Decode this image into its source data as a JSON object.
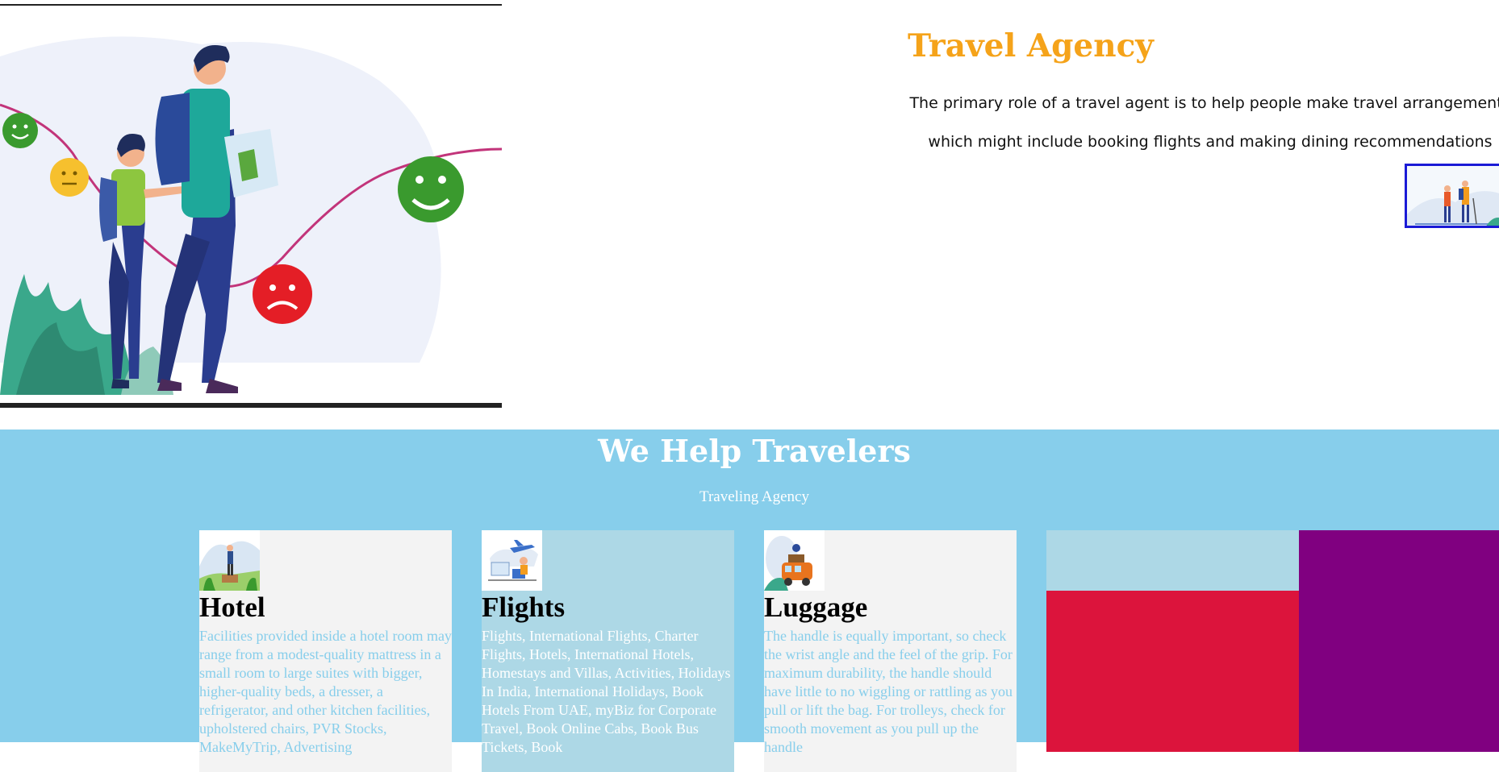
{
  "agency": {
    "title": "Travel Agency",
    "description_line1": "The primary role of a travel agent is to help people make travel arrangements",
    "description_line2": "which might include booking flights and making dining recommendations"
  },
  "section": {
    "title": "We Help Travelers",
    "subtitle": "Traveling Agency"
  },
  "cards": [
    {
      "title": "Hotel",
      "text": "Facilities provided inside a hotel room may range from a modest-quality mattress in a small room to large suites with bigger, higher-quality beds, a dresser, a refrigerator, and other kitchen facilities, upholstered chairs, PVR Stocks, MakeMyTrip, Advertising"
    },
    {
      "title": "Flights",
      "text": "Flights, International Flights, Charter Flights, Hotels, International Hotels, Homestays and Villas, Activities, Holidays In India, International Holidays, Book Hotels From UAE, myBiz for Corporate Travel, Book Online Cabs, Book Bus Tickets, Book"
    },
    {
      "title": "Luggage",
      "text": "The handle is equally important, so check the wrist angle and the feel of the grip. For maximum durability, the handle should have little to no wiggling or rattling as you pull or lift the bag. For trolleys, check for smooth movement as you pull up the handle"
    }
  ],
  "colors": {
    "title_orange": "#f5a31a",
    "section_bg": "#87ceeb",
    "card_light": "#f3f3f3",
    "card_blue": "#add8e6",
    "crimson": "#dc143c",
    "purple": "#800080",
    "thumb_border": "#1a1ad6"
  }
}
